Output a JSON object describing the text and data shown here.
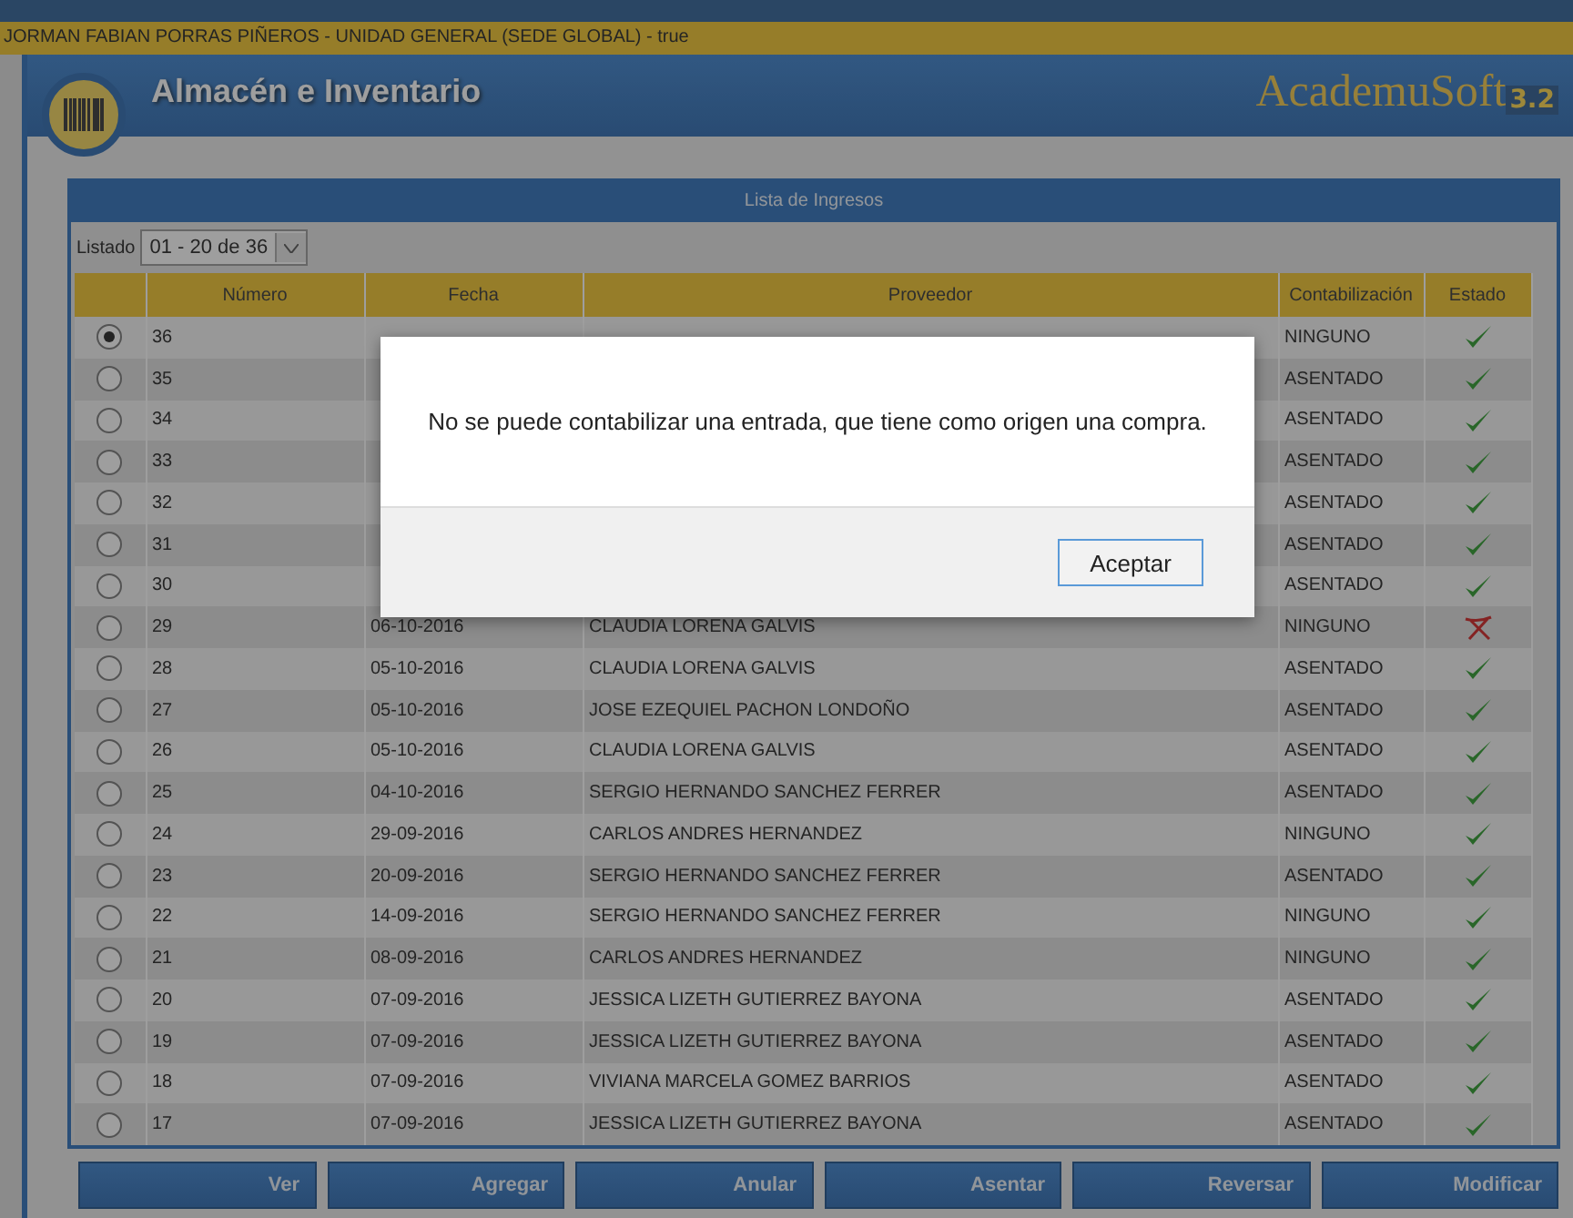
{
  "user_bar": "JORMAN FABIAN PORRAS PIÑEROS - UNIDAD GENERAL (SEDE GLOBAL) - true",
  "header": {
    "title": "Almacén e Inventario",
    "brand": "AcademuSoft",
    "version": "3.2"
  },
  "panel": {
    "title": "Lista de Ingresos",
    "listado_label": "Listado",
    "listado_value": "01 - 20 de 36"
  },
  "table": {
    "columns": [
      "Número",
      "Fecha",
      "Proveedor",
      "Contabilización",
      "Estado"
    ],
    "rows": [
      {
        "selected": true,
        "numero": "36",
        "contabilizacion": "NINGUNO",
        "valid": true
      },
      {
        "selected": false,
        "numero": "35",
        "contabilizacion": "ASENTADO",
        "valid": true
      },
      {
        "selected": false,
        "numero": "34",
        "contabilizacion": "ASENTADO",
        "valid": true
      },
      {
        "selected": false,
        "numero": "33",
        "contabilizacion": "ASENTADO",
        "valid": true
      },
      {
        "selected": false,
        "numero": "32",
        "contabilizacion": "ASENTADO",
        "valid": true
      },
      {
        "selected": false,
        "numero": "31",
        "contabilizacion": "ASENTADO",
        "valid": true
      },
      {
        "selected": false,
        "numero": "30",
        "contabilizacion": "ASENTADO",
        "valid": true
      },
      {
        "selected": false,
        "numero": "29",
        "fecha": "06-10-2016",
        "proveedor": "CLAUDIA LORENA GALVIS",
        "contabilizacion": "NINGUNO",
        "valid": false
      },
      {
        "selected": false,
        "numero": "28",
        "fecha": "05-10-2016",
        "proveedor": "CLAUDIA LORENA GALVIS",
        "contabilizacion": "ASENTADO",
        "valid": true
      },
      {
        "selected": false,
        "numero": "27",
        "fecha": "05-10-2016",
        "proveedor": "JOSE EZEQUIEL PACHON LONDOÑO",
        "contabilizacion": "ASENTADO",
        "valid": true
      },
      {
        "selected": false,
        "numero": "26",
        "fecha": "05-10-2016",
        "proveedor": "CLAUDIA LORENA GALVIS",
        "contabilizacion": "ASENTADO",
        "valid": true
      },
      {
        "selected": false,
        "numero": "25",
        "fecha": "04-10-2016",
        "proveedor": "SERGIO HERNANDO SANCHEZ FERRER",
        "contabilizacion": "ASENTADO",
        "valid": true
      },
      {
        "selected": false,
        "numero": "24",
        "fecha": "29-09-2016",
        "proveedor": "CARLOS ANDRES HERNANDEZ",
        "contabilizacion": "NINGUNO",
        "valid": true
      },
      {
        "selected": false,
        "numero": "23",
        "fecha": "20-09-2016",
        "proveedor": "SERGIO HERNANDO SANCHEZ FERRER",
        "contabilizacion": "ASENTADO",
        "valid": true
      },
      {
        "selected": false,
        "numero": "22",
        "fecha": "14-09-2016",
        "proveedor": "SERGIO HERNANDO SANCHEZ FERRER",
        "contabilizacion": "NINGUNO",
        "valid": true
      },
      {
        "selected": false,
        "numero": "21",
        "fecha": "08-09-2016",
        "proveedor": "CARLOS ANDRES HERNANDEZ",
        "contabilizacion": "NINGUNO",
        "valid": true
      },
      {
        "selected": false,
        "numero": "20",
        "fecha": "07-09-2016",
        "proveedor": "JESSICA LIZETH GUTIERREZ BAYONA",
        "contabilizacion": "ASENTADO",
        "valid": true
      },
      {
        "selected": false,
        "numero": "19",
        "fecha": "07-09-2016",
        "proveedor": "JESSICA LIZETH GUTIERREZ BAYONA",
        "contabilizacion": "ASENTADO",
        "valid": true
      },
      {
        "selected": false,
        "numero": "18",
        "fecha": "07-09-2016",
        "proveedor": "VIVIANA MARCELA GOMEZ BARRIOS",
        "contabilizacion": "ASENTADO",
        "valid": true
      },
      {
        "selected": false,
        "numero": "17",
        "fecha": "07-09-2016",
        "proveedor": "JESSICA LIZETH GUTIERREZ BAYONA",
        "contabilizacion": "ASENTADO",
        "valid": true
      }
    ]
  },
  "buttons": [
    "Ver",
    "Agregar",
    "Anular",
    "Asentar",
    "Reversar",
    "Modificar"
  ],
  "dialog": {
    "message": "No se puede contabilizar una entrada, que tiene como origen una compra.",
    "button": "Aceptar"
  }
}
